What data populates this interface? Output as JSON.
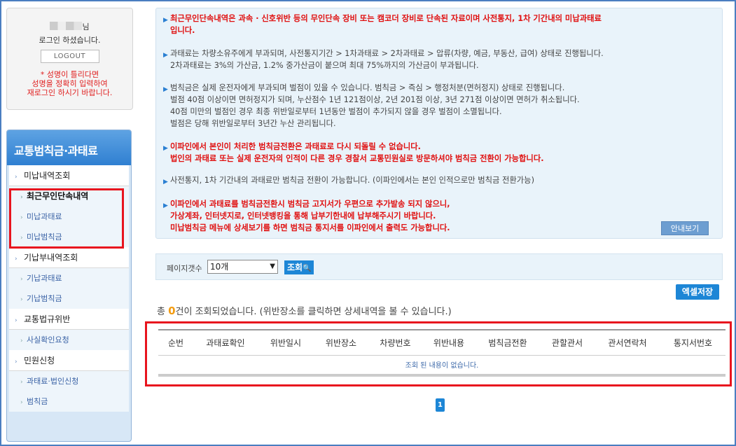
{
  "login": {
    "name_suffix": "님",
    "status": "로그인 하셨습니다.",
    "logout_label": "LOGOUT",
    "warning": [
      "* 성명이 틀리다면",
      "성명을 정확히 입력하여",
      "재로그인 하시기 바랍니다."
    ]
  },
  "sidebar": {
    "title": "교통범칙금·과태료",
    "groups": [
      {
        "label": "미납내역조회",
        "items": [
          "최근무인단속내역",
          "미납과태료",
          "미납범칙금"
        ]
      },
      {
        "label": "기납부내역조회",
        "items": [
          "기납과태료",
          "기납범칙금"
        ]
      },
      {
        "label": "교통법규위반",
        "items": [
          "사실확인요청"
        ]
      },
      {
        "label": "민원신청",
        "items": [
          "과태료·법인신청",
          "범칙금"
        ]
      }
    ]
  },
  "notice": {
    "items": [
      {
        "style": "red",
        "lines": [
          "최근무인단속내역은 과속 · 신호위반 등의 무인단속 장비 또는 캠코더 장비로 단속된 자료이며 사전통지, 1차 기간내의 미납과태료",
          "입니다."
        ]
      },
      {
        "style": "gray",
        "lines": [
          "과태료는 차량소유주에게 부과되며, 사전통지기간 > 1차과태료 > 2차과태료 > 압류(차량, 예금, 부동산, 급여) 상태로 진행됩니다.",
          "2차과태료는 3%의 가산금, 1.2% 중가산금이 붙으며 최대 75%까지의 가산금이 부과됩니다."
        ]
      },
      {
        "style": "gray",
        "lines": [
          "범칙금은 실제 운전자에게 부과되며 벌점이 있을 수 있습니다. 범칙금 > 즉심 > 행정처분(면허정지) 상태로 진행됩니다.",
          "벌점 40점 이상이면 면허정지가 되며, 누산점수 1년 121점이상, 2년 201점 이상, 3년 271점 이상이면 면허가 취소됩니다.",
          "40점 미만의 벌점인 경우 최종 위반일로부터 1년동안 벌점이 추가되지 않을 경우 벌점이 소멸됩니다.",
          "벌점은 당해 위반일로부터 3년간 누산 관리됩니다."
        ]
      },
      {
        "style": "red",
        "lines": [
          "이파인에서 본인이 처리한 범칙금전환은 과태료로 다시 되돌릴 수 없습니다.",
          "법인의 과태료 또는 실제 운전자의 인적이 다른 경우 경찰서 교통민원실로 방문하셔야 범칙금 전환이 가능합니다."
        ]
      },
      {
        "style": "gray",
        "lines": [
          "사전통지, 1차 기간내의 과태료만 범칙금 전환이 가능합니다. (이파인에서는 본인 인적으로만 범칙금 전환가능)"
        ]
      },
      {
        "style": "red",
        "lines": [
          "이파인에서 과태료를 범칙금전환시 범칙금 고지서가 우편으로 추가발송 되지 않으니,",
          "가상계좌, 인터넷지로, 인터넷뱅킹을 통해 납부기한내에 납부해주시기 바랍니다.",
          "미납범칙금 메뉴에 상세보기를 하면 범칙금 통지서를 이파인에서 출력도 가능합니다."
        ]
      }
    ],
    "guide_button": "안내보기"
  },
  "filter": {
    "label": "페이지갯수",
    "selected": "10개",
    "search_label": "조회"
  },
  "excel_button": "엑셀저장",
  "result": {
    "prefix": "총",
    "count": "0",
    "suffix": "건이 조회되었습니다. (위반장소를 클릭하면 상세내역을 볼 수 있습니다.)"
  },
  "table": {
    "columns": [
      "순번",
      "과태료확인",
      "위반일시",
      "위반장소",
      "차량번호",
      "위반내용",
      "범칙금전환",
      "관할관서",
      "관서연락처",
      "통지서번호"
    ],
    "empty_message": "조회 된 내용이 없습니다."
  },
  "pagination": {
    "current": "1"
  },
  "colors": {
    "accent": "#1d86d6",
    "highlight": "#e8141e",
    "notice_red": "#e01010"
  }
}
